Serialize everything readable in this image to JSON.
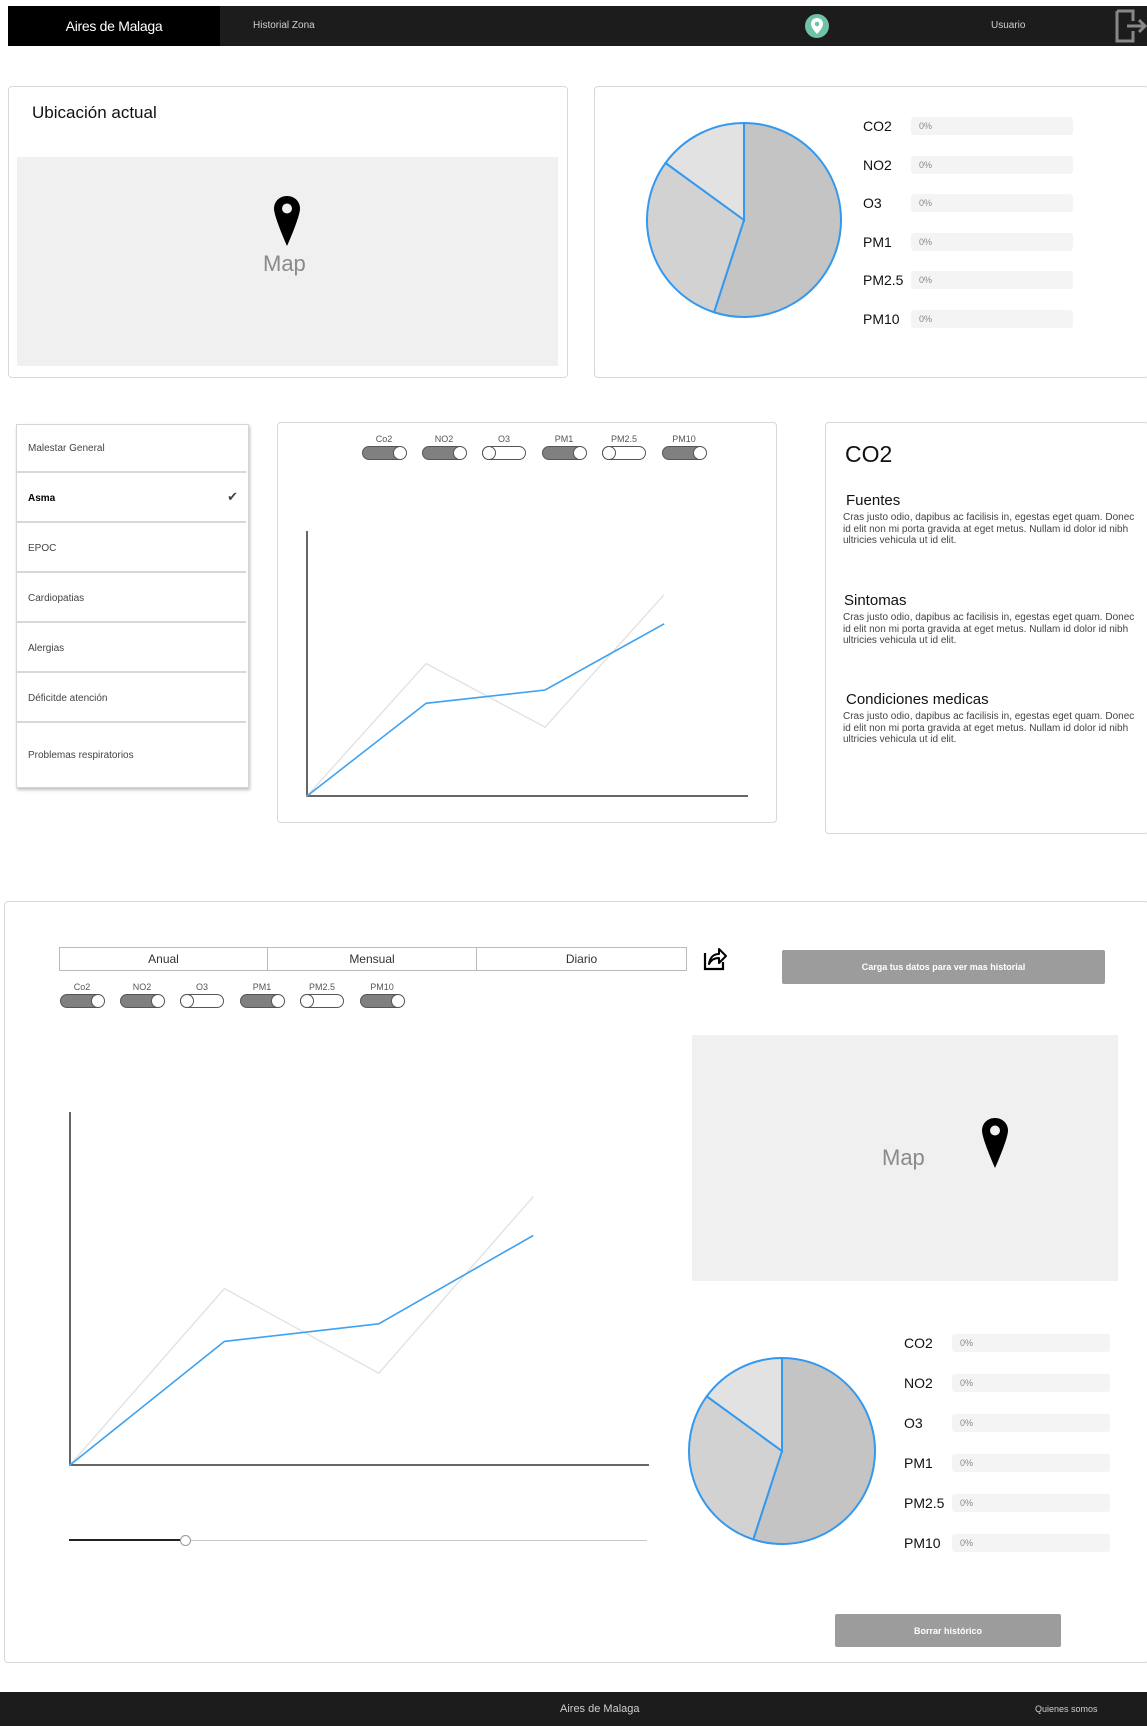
{
  "nav": {
    "brand": "Aires de Malaga",
    "historial": "Historial Zona",
    "user": "Usuario"
  },
  "ubicacion": {
    "title": "Ubicación actual",
    "map_label": "Map"
  },
  "pollutants_top": [
    {
      "label": "CO2",
      "value": "0%"
    },
    {
      "label": "NO2",
      "value": "0%"
    },
    {
      "label": "O3",
      "value": "0%"
    },
    {
      "label": "PM1",
      "value": "0%"
    },
    {
      "label": "PM2.5",
      "value": "0%"
    },
    {
      "label": "PM10",
      "value": "0%"
    }
  ],
  "conditions_menu": [
    {
      "label": "Malestar General",
      "selected": false
    },
    {
      "label": "Asma",
      "selected": true
    },
    {
      "label": "EPOC",
      "selected": false
    },
    {
      "label": "Cardiopatias",
      "selected": false
    },
    {
      "label": "Alergias",
      "selected": false
    },
    {
      "label": "Déficitde atención",
      "selected": false
    },
    {
      "label": "Problemas respiratorios",
      "selected": false
    }
  ],
  "toggles_top": [
    {
      "label": "Co2",
      "on": true
    },
    {
      "label": "NO2",
      "on": true
    },
    {
      "label": "O3",
      "on": false
    },
    {
      "label": "PM1",
      "on": true
    },
    {
      "label": "PM2.5",
      "on": false
    },
    {
      "label": "PM10",
      "on": true
    }
  ],
  "info": {
    "title": "CO2",
    "sections": [
      {
        "heading": "Fuentes",
        "text": "Cras justo odio, dapibus ac facilisis in, egestas eget quam. Donec id elit non mi porta gravida at eget metus. Nullam id dolor id nibh ultricies vehicula ut id elit."
      },
      {
        "heading": "Sintomas",
        "text": "Cras justo odio, dapibus ac facilisis in, egestas eget quam. Donec id elit non mi porta gravida at eget metus. Nullam id dolor id nibh ultricies vehicula ut id elit."
      },
      {
        "heading": "Condiciones medicas",
        "text": "Cras justo odio, dapibus ac facilisis in, egestas eget quam. Donec id elit non mi porta gravida at eget metus. Nullam id dolor id nibh ultricies vehicula ut id elit."
      }
    ]
  },
  "history": {
    "periods": [
      "Anual",
      "Mensual",
      "Diario"
    ],
    "upload_label": "Carga tus datos para ver mas historial",
    "clear_label": "Borrar histórico",
    "map_label": "Map",
    "slider_value": 0.2
  },
  "toggles_bottom": [
    {
      "label": "Co2",
      "on": true
    },
    {
      "label": "NO2",
      "on": true
    },
    {
      "label": "O3",
      "on": false
    },
    {
      "label": "PM1",
      "on": true
    },
    {
      "label": "PM2.5",
      "on": false
    },
    {
      "label": "PM10",
      "on": true
    }
  ],
  "pollutants_bottom": [
    {
      "label": "CO2",
      "value": "0%"
    },
    {
      "label": "NO2",
      "value": "0%"
    },
    {
      "label": "O3",
      "value": "0%"
    },
    {
      "label": "PM1",
      "value": "0%"
    },
    {
      "label": "PM2.5",
      "value": "0%"
    },
    {
      "label": "PM10",
      "value": "0%"
    }
  ],
  "footer": {
    "brand": "Aires de Malaga",
    "about": "Quienes somos"
  },
  "chart_data": [
    {
      "type": "pie",
      "values": [
        55,
        30,
        15
      ],
      "colors": [
        "#c4c4c4",
        "#d2d2d2",
        "#e2e2e2"
      ],
      "stroke": "#3399ee"
    },
    {
      "type": "line",
      "x": [
        0,
        1,
        2,
        3
      ],
      "series": [
        {
          "values": [
            0,
            0.35,
            0.4,
            0.65
          ],
          "color": "#3fa2f0"
        },
        {
          "values": [
            0,
            0.5,
            0.26,
            0.76
          ],
          "color": "#e2e2e2"
        }
      ],
      "ylim": [
        0,
        1
      ]
    },
    {
      "type": "line",
      "x": [
        0,
        1,
        2,
        3
      ],
      "series": [
        {
          "values": [
            0,
            0.35,
            0.4,
            0.65
          ],
          "color": "#3fa2f0"
        },
        {
          "values": [
            0,
            0.5,
            0.26,
            0.76
          ],
          "color": "#e2e2e2"
        }
      ],
      "ylim": [
        0,
        1
      ]
    },
    {
      "type": "pie",
      "values": [
        55,
        30,
        15
      ],
      "colors": [
        "#c4c4c4",
        "#d2d2d2",
        "#e2e2e2"
      ],
      "stroke": "#3399ee"
    }
  ]
}
